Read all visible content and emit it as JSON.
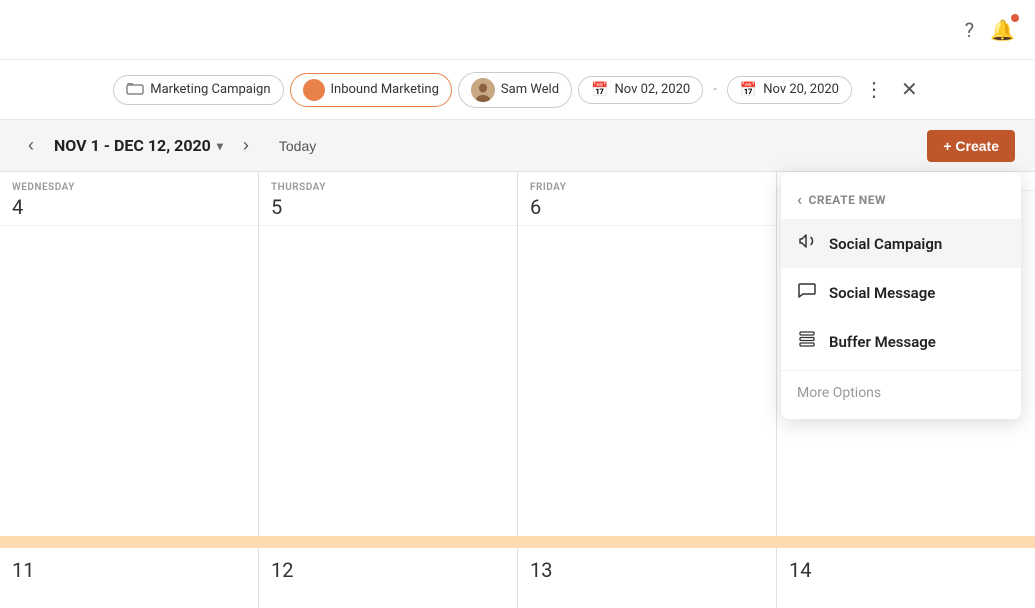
{
  "topbar": {
    "help_icon": "?",
    "notification_icon": "🔔"
  },
  "filterbar": {
    "campaign_label": "Marketing Campaign",
    "inbound_label": "Inbound Marketing",
    "user_label": "Sam Weld",
    "date_start": "Nov 02, 2020",
    "date_separator": "-",
    "date_end": "Nov 20, 2020"
  },
  "toolbar": {
    "date_range": "NOV 1 - DEC 12, 2020",
    "today_label": "Today",
    "create_label": "+ Create"
  },
  "calendar": {
    "columns": [
      {
        "day_name": "WEDNESDAY",
        "day_num": "4"
      },
      {
        "day_name": "THURSDAY",
        "day_num": "5"
      },
      {
        "day_name": "FRIDAY",
        "day_num": "6"
      },
      {
        "day_name": "",
        "day_num": ""
      }
    ],
    "bottom_nums": [
      "11",
      "12",
      "13",
      "14"
    ]
  },
  "dropdown": {
    "back_label": "CREATE NEW",
    "items": [
      {
        "id": "social-campaign",
        "label": "Social Campaign",
        "icon": "📣"
      },
      {
        "id": "social-message",
        "label": "Social Message",
        "icon": "💬"
      },
      {
        "id": "buffer-message",
        "label": "Buffer Message",
        "icon": "📋"
      }
    ],
    "more_options_label": "More Options"
  }
}
